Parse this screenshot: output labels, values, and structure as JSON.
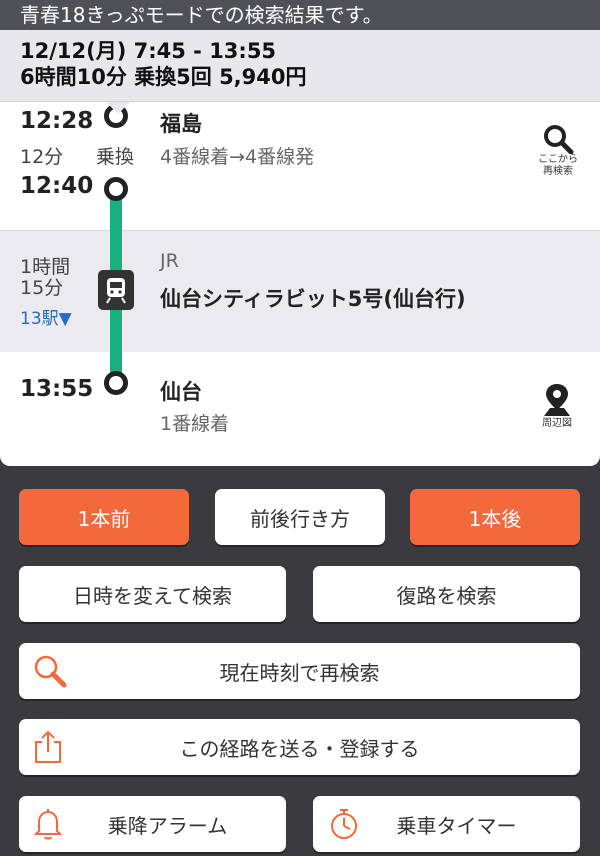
{
  "banner": "青春18きっぷモードでの検索結果です。",
  "summary": {
    "line1": "12/12(月)  7:45 - 13:55",
    "line2": "6時間10分 乗換5回 5,940円"
  },
  "route": {
    "transfer": {
      "arrive_time": "12:28",
      "station": "福島",
      "wait": "12分",
      "wait_label": "乗換",
      "platform": "4番線着→4番線発",
      "depart_time": "12:40",
      "action_label_1": "ここから",
      "action_label_2": "再検索"
    },
    "ride": {
      "duration_1": "1時間",
      "duration_2": "15分",
      "stops": "13駅▼",
      "operator": "JR",
      "train": "仙台シティラビット5号(仙台行)"
    },
    "arrival": {
      "time": "13:55",
      "station": "仙台",
      "platform": "1番線着",
      "map_label": "周辺図"
    },
    "line_color": "#17b07f"
  },
  "buttons": {
    "prev": "1本前",
    "around": "前後行き方",
    "next": "1本後",
    "change_datetime": "日時を変えて検索",
    "return_route": "復路を検索",
    "research_now": "現在時刻で再検索",
    "send_register": "この経路を送る・登録する",
    "alarm": "乗降アラーム",
    "timer": "乗車タイマー"
  },
  "colors": {
    "accent": "#f26a3c",
    "background": "#3a3a3f"
  }
}
